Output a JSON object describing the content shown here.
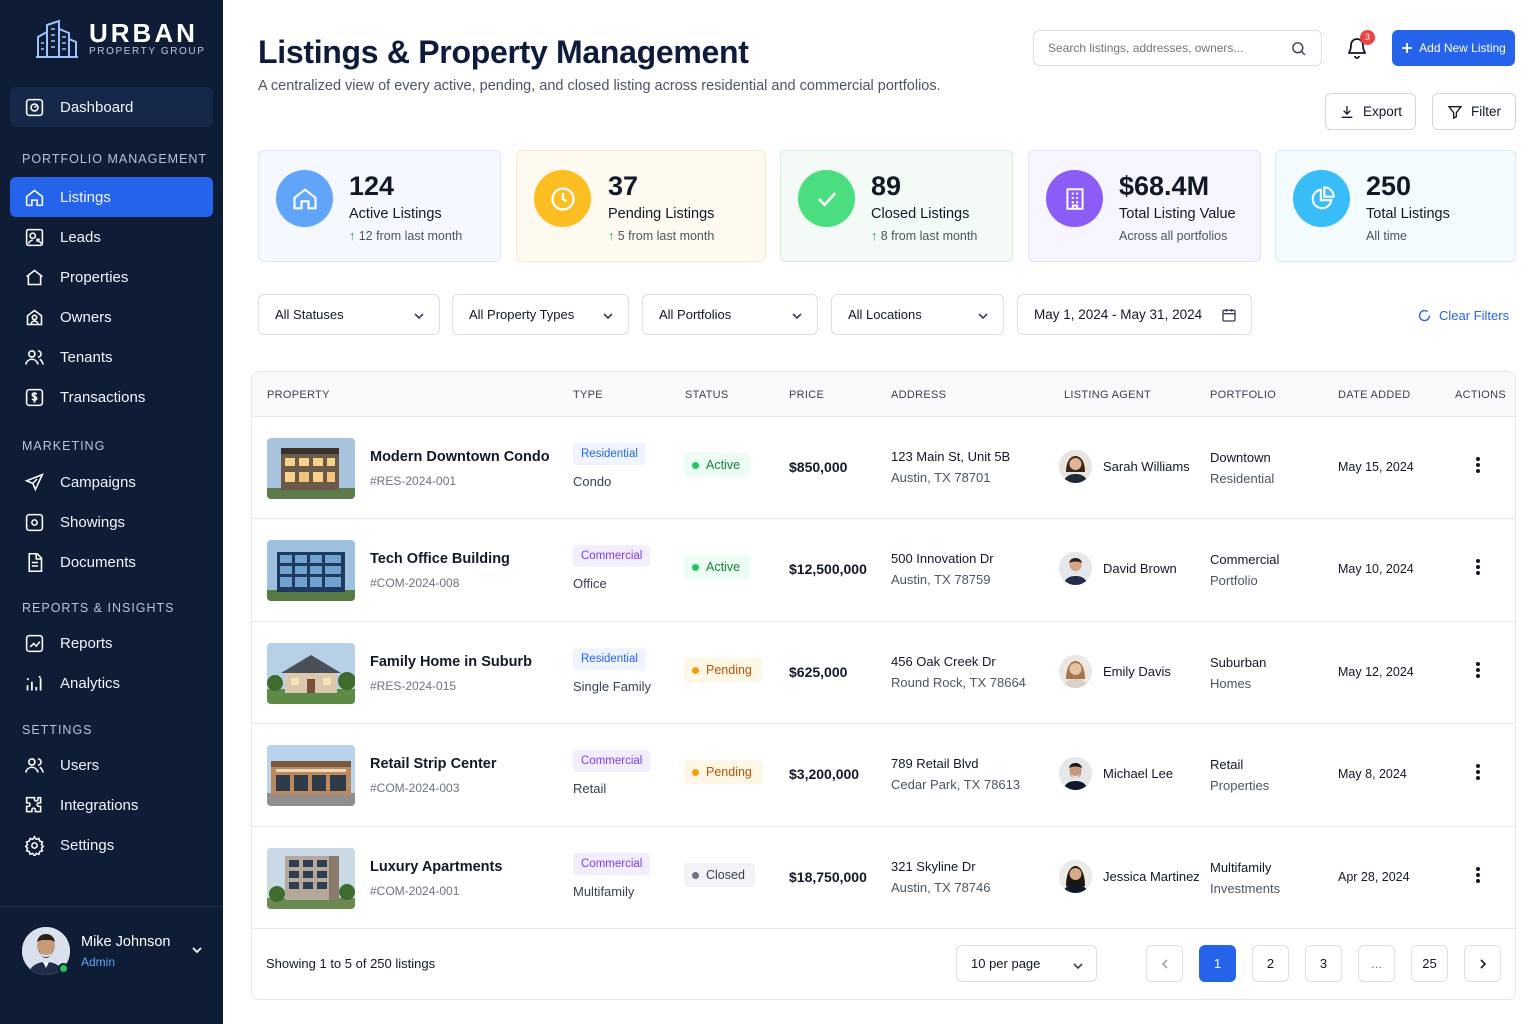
{
  "brand": {
    "name": "URBAN",
    "tagline": "PROPERTY GROUP"
  },
  "sidebar": {
    "dashboard": "Dashboard",
    "sections": [
      {
        "title": "PORTFOLIO MANAGEMENT",
        "items": [
          "Listings",
          "Leads",
          "Properties",
          "Owners",
          "Tenants",
          "Transactions"
        ]
      },
      {
        "title": "MARKETING",
        "items": [
          "Campaigns",
          "Showings",
          "Documents"
        ]
      },
      {
        "title": "REPORTS & INSIGHTS",
        "items": [
          "Reports",
          "Analytics"
        ]
      },
      {
        "title": "SETTINGS",
        "items": [
          "Users",
          "Integrations",
          "Settings"
        ]
      }
    ],
    "active_item": "Listings"
  },
  "user": {
    "name": "Mike Johnson",
    "role": "Admin"
  },
  "header": {
    "title": "Listings & Property Management",
    "subtitle": "A centralized view of every active, pending, and closed listing across residential and commercial portfolios.",
    "search_placeholder": "Search listings, addresses, owners...",
    "notification_count": "3",
    "add_button": "Add New Listing",
    "export_button": "Export",
    "filter_button": "Filter"
  },
  "stats": [
    {
      "value": "124",
      "label": "Active Listings",
      "delta": "12",
      "delta_text": "from last month",
      "color": "#60a5fa"
    },
    {
      "value": "37",
      "label": "Pending Listings",
      "delta": "5",
      "delta_text": "from last month",
      "color": "#fbbf24"
    },
    {
      "value": "89",
      "label": "Closed Listings",
      "delta": "8",
      "delta_text": "from last month",
      "color": "#4ade80"
    },
    {
      "value": "$68.4M",
      "label": "Total Listing Value",
      "note": "Across all portfolios",
      "color": "#8b5cf6"
    },
    {
      "value": "250",
      "label": "Total Listings",
      "note": "All time",
      "color": "#38bdf8"
    }
  ],
  "filters": {
    "status": "All Statuses",
    "property_type": "All Property Types",
    "portfolio": "All Portfolios",
    "location": "All Locations",
    "date_range": "May 1, 2024 - May 31, 2024",
    "clear": "Clear Filters"
  },
  "table": {
    "columns": [
      "PROPERTY",
      "TYPE",
      "STATUS",
      "PRICE",
      "ADDRESS",
      "LISTING AGENT",
      "PORTFOLIO",
      "DATE ADDED",
      "ACTIONS"
    ],
    "rows": [
      {
        "name": "Modern Downtown Condo",
        "id": "#RES-2024-001",
        "category": "Residential",
        "type": "Condo",
        "status": "Active",
        "price": "$850,000",
        "address1": "123 Main St, Unit 5B",
        "address2": "Austin, TX 78701",
        "agent": "Sarah Williams",
        "portfolio1": "Downtown",
        "portfolio2": "Residential",
        "date": "May 15, 2024"
      },
      {
        "name": "Tech Office Building",
        "id": "#COM-2024-008",
        "category": "Commercial",
        "type": "Office",
        "status": "Active",
        "price": "$12,500,000",
        "address1": "500 Innovation Dr",
        "address2": "Austin, TX 78759",
        "agent": "David Brown",
        "portfolio1": "Commercial",
        "portfolio2": "Portfolio",
        "date": "May 10, 2024"
      },
      {
        "name": "Family Home in Suburb",
        "id": "#RES-2024-015",
        "category": "Residential",
        "type": "Single Family",
        "status": "Pending",
        "price": "$625,000",
        "address1": "456 Oak Creek Dr",
        "address2": "Round Rock, TX 78664",
        "agent": "Emily Davis",
        "portfolio1": "Suburban",
        "portfolio2": "Homes",
        "date": "May 12, 2024"
      },
      {
        "name": "Retail Strip Center",
        "id": "#COM-2024-003",
        "category": "Commercial",
        "type": "Retail",
        "status": "Pending",
        "price": "$3,200,000",
        "address1": "789 Retail Blvd",
        "address2": "Cedar Park, TX 78613",
        "agent": "Michael Lee",
        "portfolio1": "Retail",
        "portfolio2": "Properties",
        "date": "May 8, 2024"
      },
      {
        "name": "Luxury Apartments",
        "id": "#COM-2024-001",
        "category": "Commercial",
        "type": "Multifamily",
        "status": "Closed",
        "price": "$18,750,000",
        "address1": "321 Skyline Dr",
        "address2": "Austin, TX 78746",
        "agent": "Jessica Martinez",
        "portfolio1": "Multifamily",
        "portfolio2": "Investments",
        "date": "Apr 28, 2024"
      }
    ]
  },
  "pagination": {
    "summary": "Showing 1 to 5 of 250 listings",
    "per_page": "10 per page",
    "pages": [
      "1",
      "2",
      "3",
      "...",
      "25"
    ],
    "current": "1"
  },
  "colors": {
    "sidebar_bg": "#0e1c36",
    "accent": "#2563eb"
  }
}
